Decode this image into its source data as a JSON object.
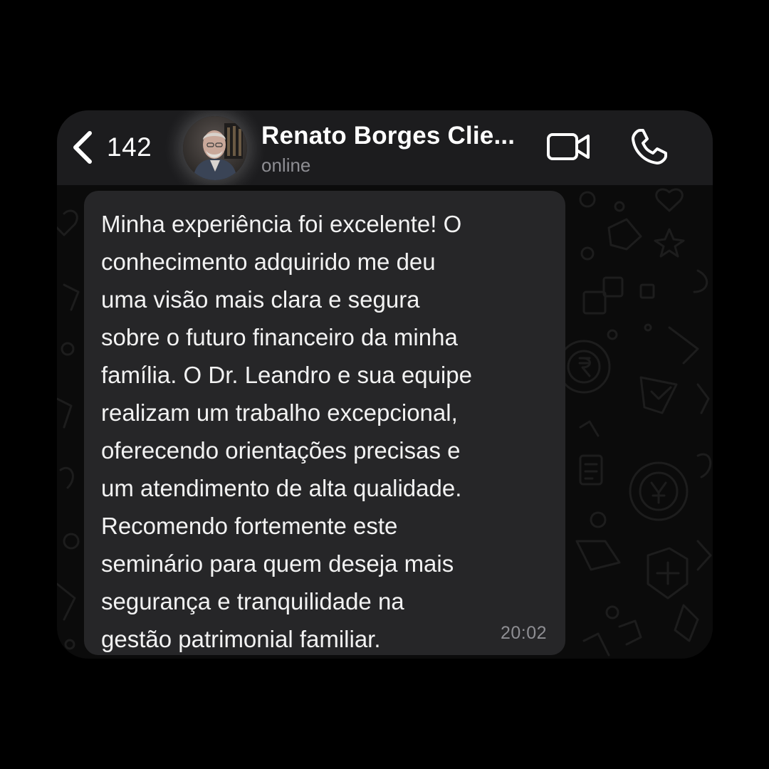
{
  "header": {
    "back_count": "142",
    "contact_name": "Renato Borges Clie...",
    "contact_status": "online",
    "video_call_icon": "video-camera-icon",
    "voice_call_icon": "phone-icon"
  },
  "message": {
    "lines": [
      "Minha experiência foi excelente! O",
      "conhecimento adquirido me deu",
      "uma visão mais clara e segura",
      "sobre o futuro financeiro da minha",
      "família. O Dr. Leandro e sua equipe",
      "realizam um trabalho excepcional,",
      "oferecendo orientações precisas e",
      "um atendimento de alta qualidade.",
      "Recomendo fortemente este",
      "seminário para quem deseja mais",
      "segurança e tranquilidade na",
      "gestão patrimonial familiar."
    ],
    "time": "20:02"
  },
  "colors": {
    "background": "#000000",
    "header_bg": "#1c1c1e",
    "chat_bg": "#0b0b0b",
    "bubble_bg": "#262628",
    "text": "#f2f2f2",
    "secondary_text": "#8e8e93"
  }
}
